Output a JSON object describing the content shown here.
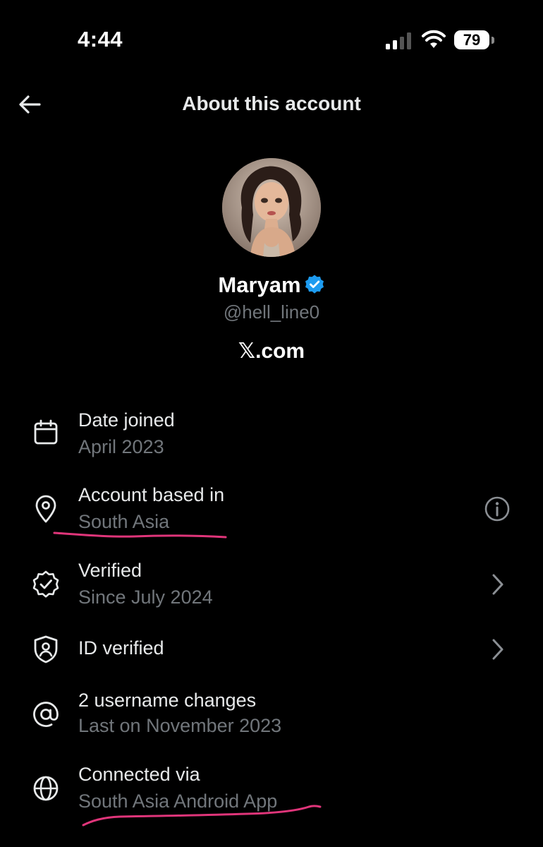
{
  "status_bar": {
    "time": "4:44",
    "battery": "79"
  },
  "header": {
    "title": "About this account",
    "back_icon": "arrow-left-icon"
  },
  "profile": {
    "name": "Maryam",
    "handle": "@hell_line0",
    "brand_x": "𝕏",
    "brand_suffix": ".com",
    "verified_color": "#1d9bf0"
  },
  "rows": [
    {
      "icon": "calendar-icon",
      "title": "Date joined",
      "subtitle": "April 2023"
    },
    {
      "icon": "location-pin-icon",
      "title": "Account based in",
      "subtitle": "South Asia",
      "action_icon": "info-icon"
    },
    {
      "icon": "verified-badge-icon",
      "title": "Verified",
      "subtitle": "Since July 2024",
      "action_icon": "chevron-right-icon"
    },
    {
      "icon": "id-shield-icon",
      "title": "ID verified",
      "action_icon": "chevron-right-icon"
    },
    {
      "icon": "at-sign-icon",
      "title": "2 username changes",
      "subtitle": "Last on November 2023"
    },
    {
      "icon": "globe-icon",
      "title": "Connected via",
      "subtitle": "South Asia Android App"
    }
  ],
  "colors": {
    "background": "#000000",
    "text_primary": "#e7e9ea",
    "text_secondary": "#71767b",
    "annotation_underline": "#e0357a"
  }
}
